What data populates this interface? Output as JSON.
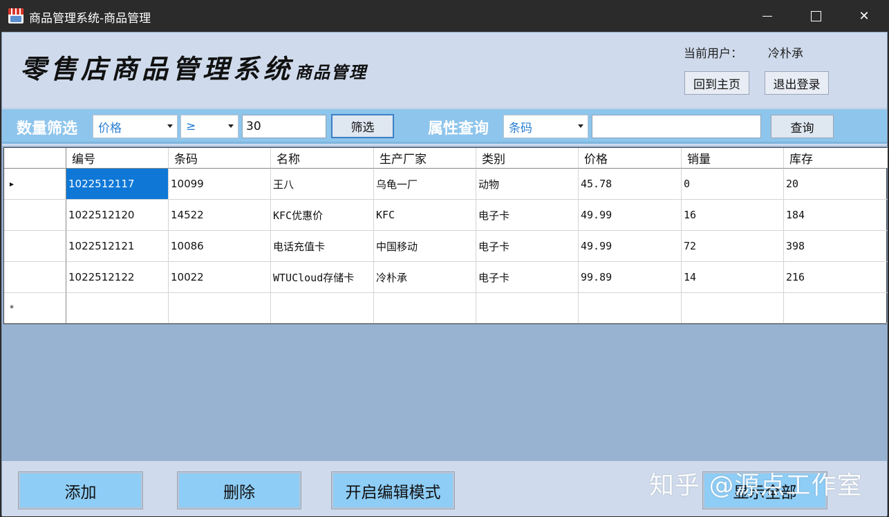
{
  "window": {
    "title": "商品管理系统-商品管理",
    "icon": "store-icon"
  },
  "header": {
    "logo_main": "零售店商品管理系统",
    "logo_sub": "商品管理",
    "user_label": "当前用户：",
    "user_name": "冷朴承",
    "home_button": "回到主页",
    "logout_button": "退出登录"
  },
  "filter": {
    "quantity_title": "数量筛选",
    "field_value": "价格",
    "operator_value": "≥",
    "amount_value": "30",
    "filter_button": "筛选",
    "attribute_title": "属性查询",
    "attribute_value": "条码",
    "query_value": "",
    "query_button": "查询"
  },
  "table": {
    "columns": [
      "编号",
      "条码",
      "名称",
      "生产厂家",
      "类别",
      "价格",
      "销量",
      "库存"
    ],
    "rows": [
      [
        "1022512117",
        "10099",
        "王八",
        "乌龟一厂",
        "动物",
        "45.78",
        "0",
        "20"
      ],
      [
        "1022512120",
        "14522",
        "KFC优惠价",
        "KFC",
        "电子卡",
        "49.99",
        "16",
        "184"
      ],
      [
        "1022512121",
        "10086",
        "电话充值卡",
        "中国移动",
        "电子卡",
        "49.99",
        "72",
        "398"
      ],
      [
        "1022512122",
        "10022",
        "WTUCloud存储卡",
        "冷朴承",
        "电子卡",
        "99.89",
        "14",
        "216"
      ]
    ],
    "current_row_marker": "▸",
    "new_row_marker": "*"
  },
  "footer": {
    "add_button": "添加",
    "delete_button": "删除",
    "edit_mode_button": "开启编辑模式",
    "show_all_button": "显示全部",
    "watermark": "知乎 @源点工作室"
  },
  "colors": {
    "title_bar": "#2b2b2b",
    "panel": "#cfdbec",
    "filter_bar": "#8ec5ec",
    "grid_bg": "#98b2d2",
    "selection": "#0f78d7",
    "big_button": "#8ecdf6"
  }
}
